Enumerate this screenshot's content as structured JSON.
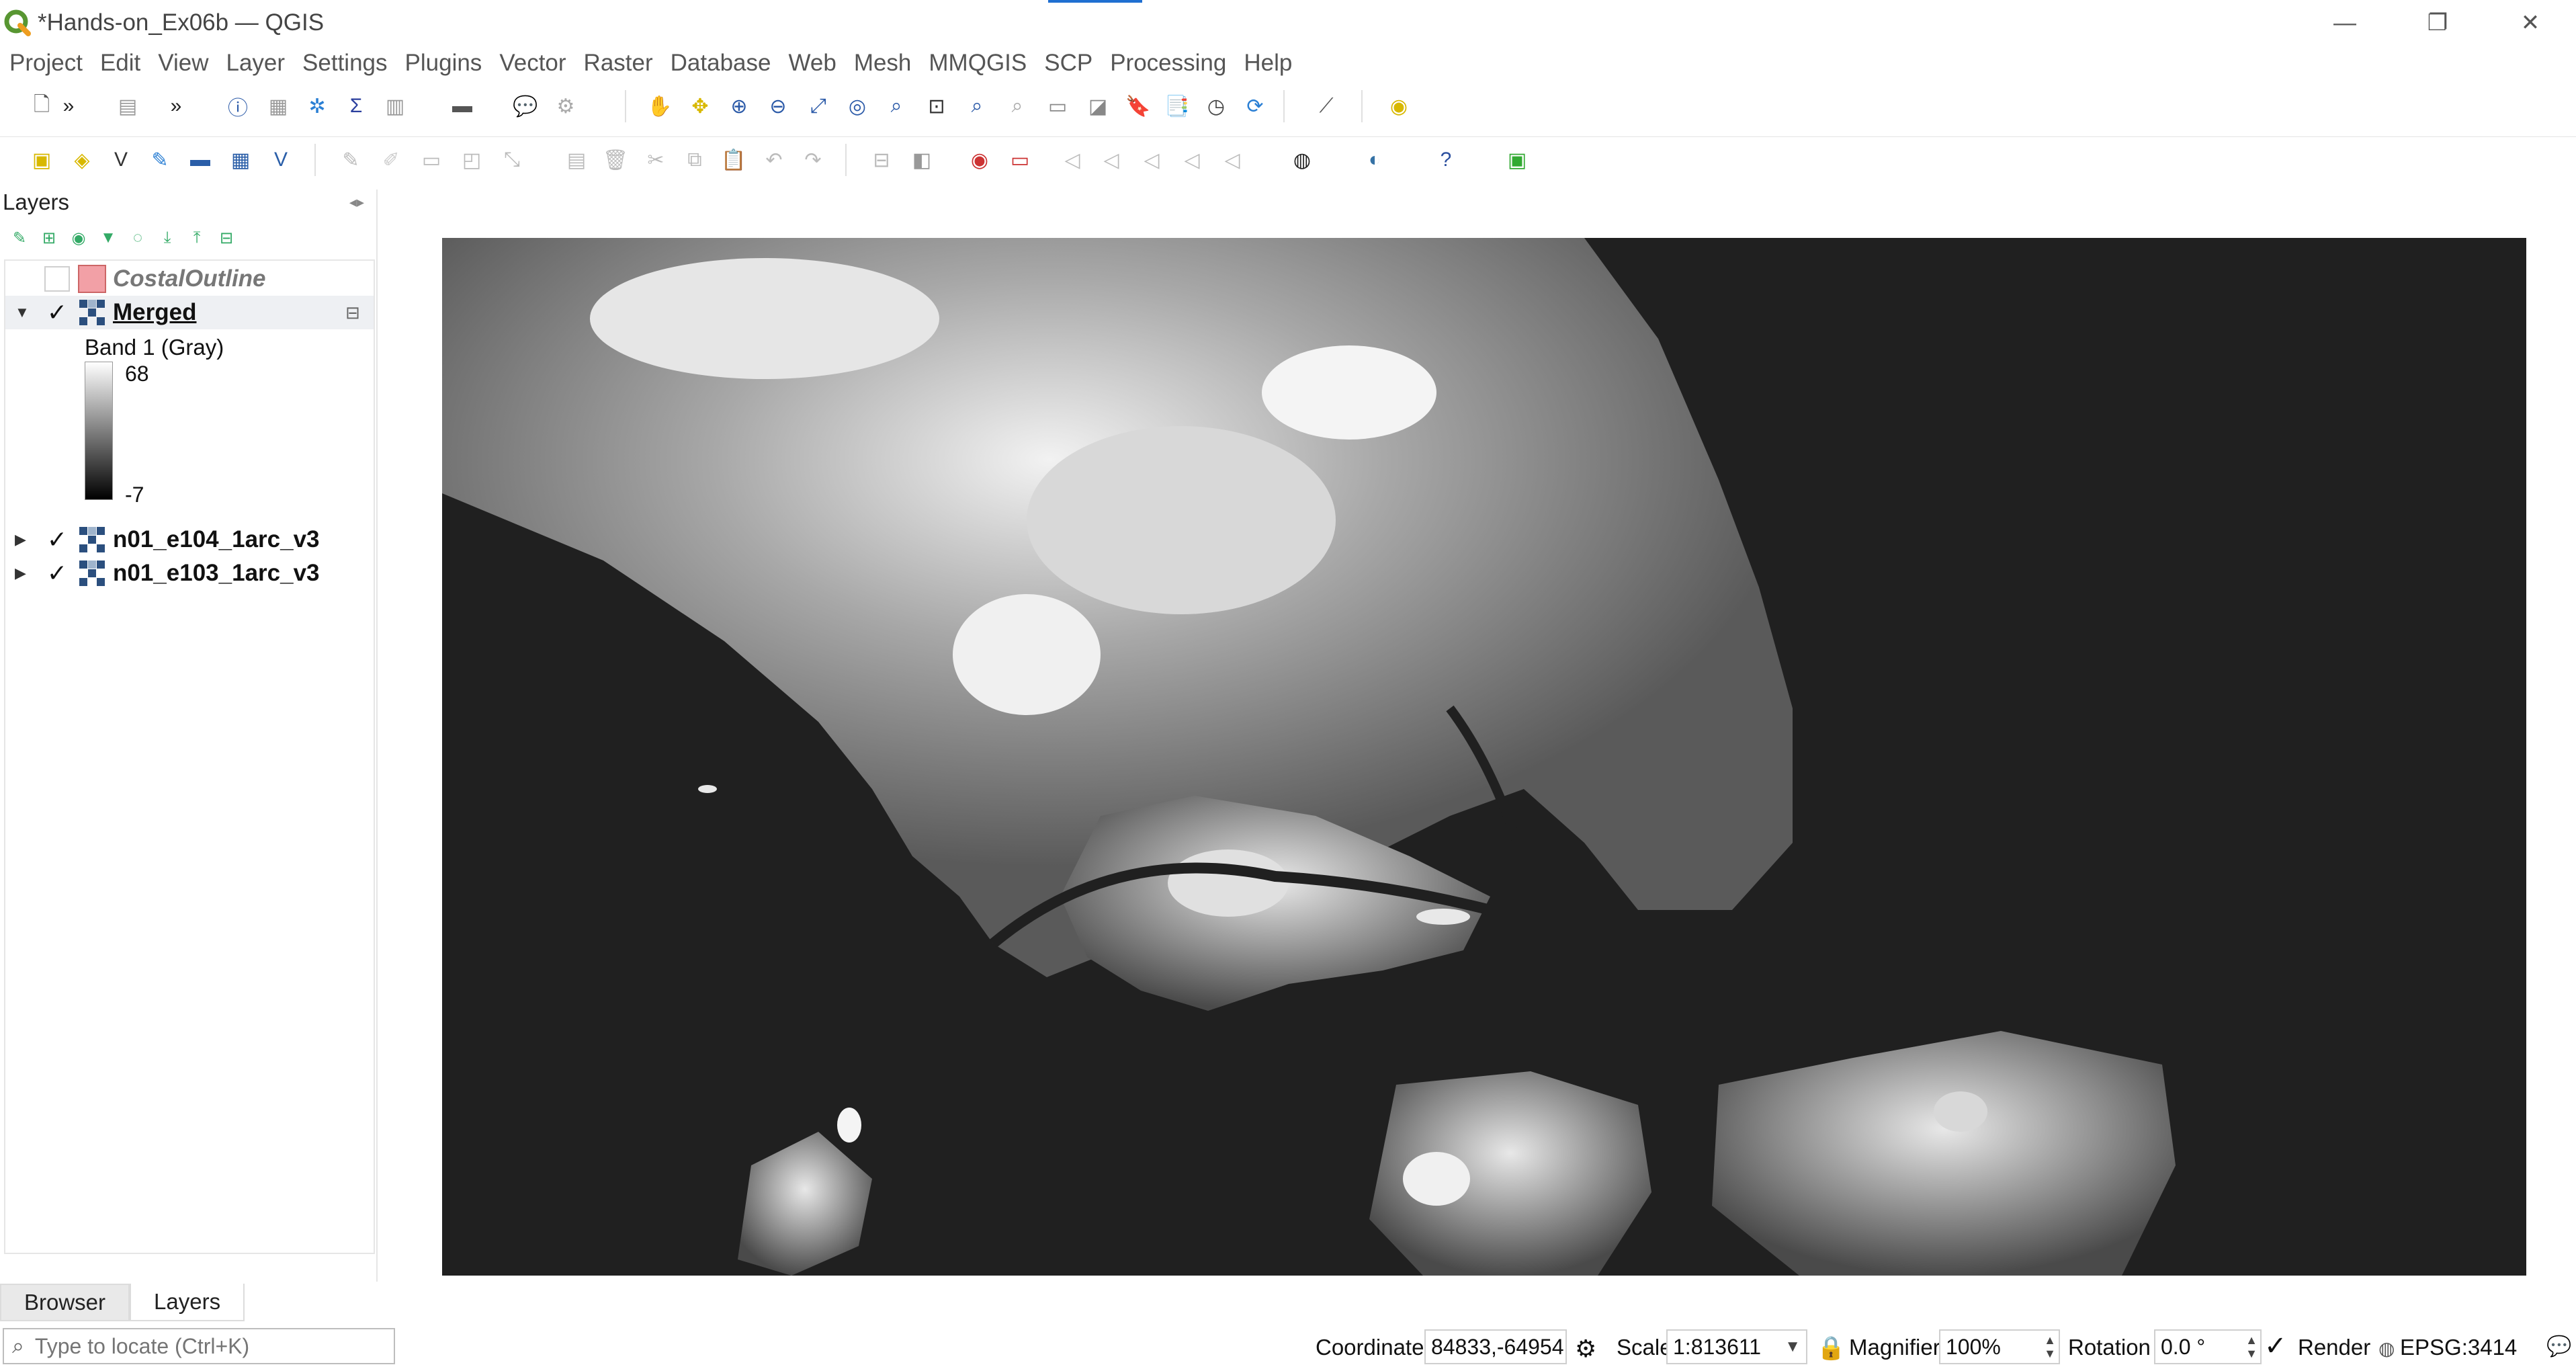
{
  "window": {
    "title": "*Hands-on_Ex06b — QGIS",
    "controls": {
      "minimize": "—",
      "restore": "❐",
      "close": "✕"
    }
  },
  "menubar": {
    "items": [
      "Project",
      "Edit",
      "View",
      "Layer",
      "Settings",
      "Plugins",
      "Vector",
      "Raster",
      "Database",
      "Web",
      "Mesh",
      "MMQGIS",
      "SCP",
      "Processing",
      "Help"
    ]
  },
  "toolbar1": {
    "icons": [
      "new-project-icon",
      "more-chevron-icon",
      "select-features-icon",
      "more-chevron-icon",
      "identify-icon",
      "attribute-table-icon",
      "toolbox-icon",
      "statistics-icon",
      "open-field-calculator-icon",
      "measure-icon",
      "map-tips-icon",
      "select-by-value-icon",
      "pan-icon",
      "pan-to-selection-icon",
      "zoom-in-icon",
      "zoom-out-icon",
      "zoom-full-icon",
      "zoom-to-selection-icon",
      "zoom-to-layer-icon",
      "zoom-native-icon",
      "zoom-last-icon",
      "zoom-next-icon",
      "new-map-view-icon",
      "new-3d-view-icon",
      "spatial-bookmark-icon",
      "show-bookmarks-icon",
      "temporal-controller-icon",
      "refresh-icon",
      "profile-tool-icon",
      "plugin-icon"
    ]
  },
  "toolbar2": {
    "icons": [
      "data-source-manager-icon",
      "new-geopackage-icon",
      "new-shapefile-icon",
      "new-spatialite-icon",
      "new-virtual-layer-icon",
      "new-mesh-icon",
      "new-vector-tile-icon",
      "edit-toggle-icon",
      "pencil-icon",
      "save-edits-icon",
      "add-feature-icon",
      "vertex-tool-icon",
      "modify-attributes-icon",
      "delete-icon",
      "cut-icon",
      "copy-icon",
      "paste-icon",
      "undo-icon",
      "redo-icon",
      "label-toolbar-icon",
      "label-pin-icon",
      "label-abc-icon",
      "label-abc-red-icon",
      "label-show-icon",
      "label-move-icon",
      "label-rotate-icon",
      "label-change-icon",
      "label-highlight-icon",
      "osm-icon",
      "python-console-icon",
      "help-icon",
      "scp-icon"
    ]
  },
  "layers_panel": {
    "title": "Layers",
    "layers": [
      {
        "name": "CostalOutline",
        "checked": false,
        "expanded": false,
        "type": "vector-polygon",
        "color": "#f2a0a6"
      },
      {
        "name": "Merged",
        "checked": true,
        "expanded": true,
        "type": "raster"
      },
      {
        "name": "n01_e104_1arc_v3",
        "checked": true,
        "expanded": false,
        "type": "raster"
      },
      {
        "name": "n01_e103_1arc_v3",
        "checked": true,
        "expanded": false,
        "type": "raster"
      }
    ],
    "legend": {
      "band_label": "Band 1 (Gray)",
      "max_value": "68",
      "min_value": "-7"
    }
  },
  "bottom_tabs": {
    "browser": "Browser",
    "layers": "Layers",
    "active": "Layers"
  },
  "statusbar": {
    "locator_placeholder": "Type to locate (Ctrl+K)",
    "coordinate_label": "Coordinate",
    "coordinate_value": "84833,-64954",
    "scale_label": "Scale",
    "scale_value": "1:813611",
    "magnifier_label": "Magnifier",
    "magnifier_value": "100%",
    "rotation_label": "Rotation",
    "rotation_value": "0.0 °",
    "render_label": "Render",
    "render_checked": true,
    "crs": "EPSG:3414"
  },
  "map": {
    "background_color": "#202020",
    "description_layer": "Merged"
  }
}
